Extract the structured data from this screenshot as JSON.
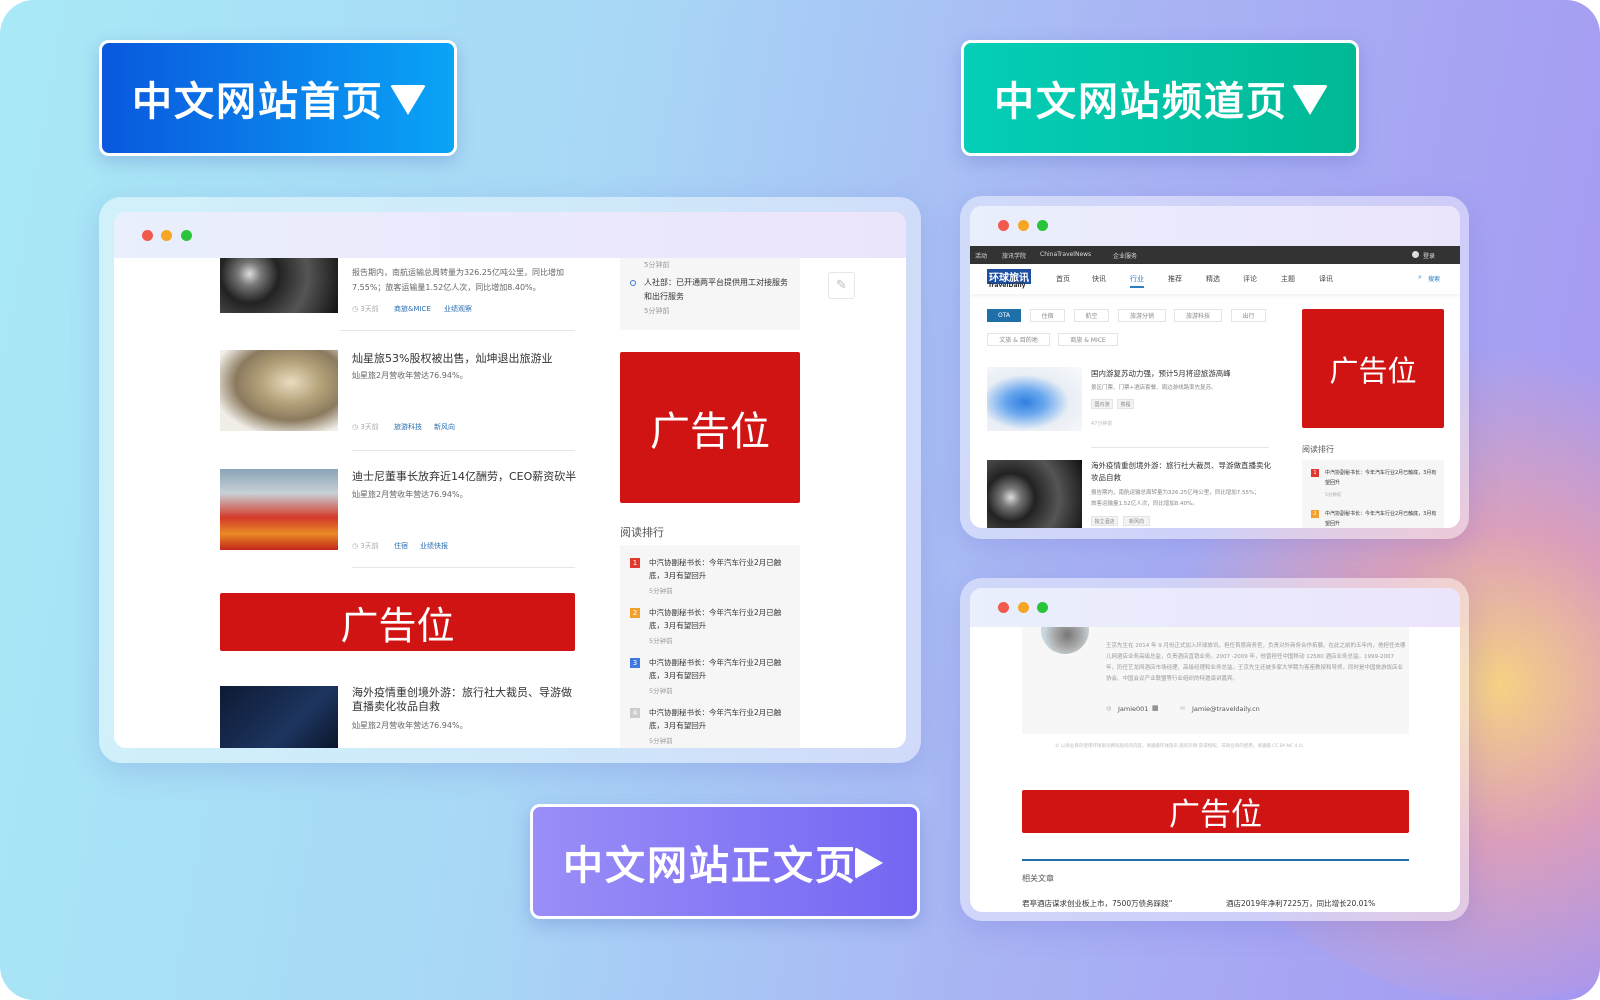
{
  "buttons": {
    "home": {
      "label": "中文网站首页",
      "icon": "triangle-down-icon",
      "color": "#0a64e6"
    },
    "channel": {
      "label": "中文网站频道页",
      "icon": "triangle-down-icon",
      "color": "#00c6a6"
    },
    "article": {
      "label": "中文网站正文页",
      "icon": "play-icon",
      "color": "#8478f6"
    }
  },
  "ad_label": "广告位",
  "ad_color": "#d01414",
  "home_page": {
    "articles": [
      {
        "title": "",
        "summary": "报告期内，南航运输总周转量为326.25亿吨公里，同比增加7.55%；旅客运输量1.52亿人次，同比增加8.40%。",
        "time": "3天前",
        "tags": [
          "商旅&MICE",
          "业绩观察"
        ]
      },
      {
        "title": "灿星旅53%股权被出售，灿坤退出旅游业",
        "summary": "灿星旅2月营收年营达76.94%。",
        "time": "3天前",
        "tags": [
          "旅游科技",
          "新风向"
        ]
      },
      {
        "title": "迪士尼董事长放弃近14亿酬劳，CEO薪资砍半",
        "summary": "灿星旅2月营收年营达76.94%。",
        "time": "3天前",
        "tags": [
          "住宿",
          "业绩快报"
        ]
      },
      {
        "title": "海外疫情重创境外游：旅行社大裁员、导游做直播卖化妆品自救",
        "summary": "灿星旅2月营收年营达76.94%。"
      }
    ],
    "timeline": [
      {
        "time": "5分钟前"
      },
      {
        "title": "人社部：已开通两平台提供用工对接服务和出行服务",
        "time": "5分钟前"
      }
    ],
    "ranking_title": "阅读排行",
    "ranking": [
      {
        "rank": "1",
        "title": "中汽协副秘书长：今年汽车行业2月已触底，3月有望回升",
        "time": "5分钟前",
        "color": "#e03a2e"
      },
      {
        "rank": "2",
        "title": "中汽协副秘书长：今年汽车行业2月已触底，3月有望回升",
        "time": "5分钟前",
        "color": "#f2a02c"
      },
      {
        "rank": "3",
        "title": "中汽协副秘书长：今年汽车行业2月已触底，3月有望回升",
        "time": "5分钟前",
        "color": "#3f78e0"
      },
      {
        "rank": "4",
        "title": "中汽协副秘书长：今年汽车行业2月已触底，3月有望回升",
        "time": "5分钟前",
        "color": "#cccccc"
      }
    ]
  },
  "channel_page": {
    "topbar": [
      "活动",
      "旅讯学院",
      "ChinaTravelNews",
      "企业服务"
    ],
    "login": "登录",
    "logo": {
      "cn": "环球旅讯",
      "en": "TravelDaily"
    },
    "nav": [
      "首页",
      "快讯",
      "行业",
      "推荐",
      "精选",
      "评论",
      "主题",
      "译讯"
    ],
    "nav_active": 2,
    "search": "搜索",
    "filters": [
      "OTA",
      "住宿",
      "航空",
      "旅游分销",
      "旅游科技",
      "出行",
      "文旅 & 目的地",
      "商旅 & MICE"
    ],
    "articles": [
      {
        "title": "国内游复苏动力强，预计5月将迎旅游高峰",
        "summary": "景区门票、门票+酒店套餐、周边游线路率先复苏。",
        "tags": [
          "国内游",
          "携程"
        ],
        "time": "47分钟前"
      },
      {
        "title": "海外疫情重创境外游：旅行社大裁员、导游做直播卖化妆品自救",
        "summary": "报告期内，南航运输总周转量为326.25亿吨公里，同比增加7.55%；旅客运输量1.52亿人次，同比增加8.40%。",
        "tags": [
          "独立酒店",
          "新风向"
        ]
      }
    ],
    "ranking_title": "阅读排行",
    "ranking": [
      {
        "rank": "1",
        "title": "中汽协副秘书长：今年汽车行业2月已触底，3月有望回升",
        "time": "5分钟前",
        "color": "#e03a2e"
      },
      {
        "rank": "2",
        "title": "中汽协副秘书长：今年汽车行业2月已触底，3月有望回升",
        "color": "#f2a02c"
      }
    ]
  },
  "article_page": {
    "bio": "王京先生在 2014 年 9 月份正式加入环球旅讯，担任首席商务官，负责对外商务合作拓展。在此之前的五年内，他担任去哪儿网酒店业务高级总监，负责酒店直销业务。2007 -2009 年，他曾担任中国移动 12580 酒店业务总监。1999-2007 年，历任艺龙网酒店市场经理、高级经理和业务总监。王京先生还被多家大学聘为客座教授和导师，同时是中国旅游饭店业协会、中国会议产业联盟等行业组织的特邀演讲嘉宾。",
    "wechat": "Jamie001",
    "email": "Jamie@traveldaily.cn",
    "copyright": "© 以商业目的使用环球旅讯拥有版权的内容，请遵循环球旅讯 版权声明 获得授权。非商业目的使用，请遵循 CC BY-NC 4.0。",
    "related_title": "相关文章",
    "related": [
      "君亭酒店谋求创业板上市，7500万债务踩跷“",
      "酒店2019年净利7225万，同比增长20.01%"
    ]
  }
}
